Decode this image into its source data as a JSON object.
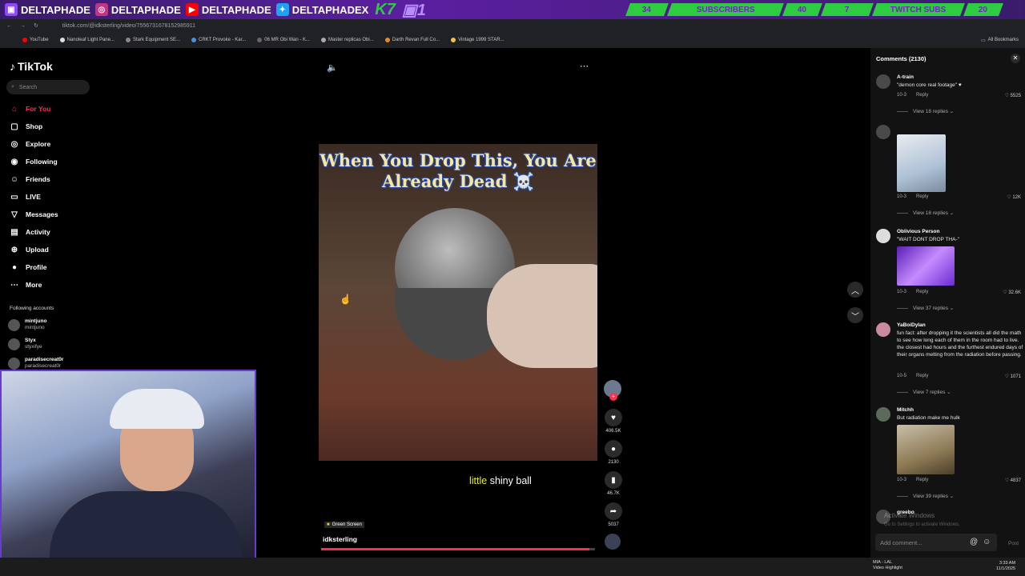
{
  "stream_overlay": {
    "handles": [
      {
        "icon": "twitch-icon",
        "label": "DELTAPHADE"
      },
      {
        "icon": "instagram-icon",
        "label": "DELTAPHADE"
      },
      {
        "icon": "youtube-icon",
        "label": "DELTAPHADE"
      },
      {
        "icon": "twitter-icon",
        "label": "DELTAPHADEX"
      }
    ],
    "kick_count": "7",
    "twitch_count": "1",
    "subs_current": "34",
    "subs_label": "SUBSCRIBERS",
    "subs_goal": "40",
    "twitch_subs_current": "7",
    "twitch_subs_label": "TWITCH SUBS",
    "twitch_subs_goal": "20"
  },
  "browser": {
    "url": "tiktok.com/@idksterling/video/7556731678152985911",
    "bookmarks": [
      "YouTube",
      "Nanoleaf Light Pane...",
      "Stark Equipment SE...",
      "CRKT Provoke - Kar...",
      "06 MR Obi Wan - K...",
      "Master replicas Obi...",
      "Darth Revan Full Co...",
      "Vintage 1999 STAR..."
    ],
    "all_bookmarks": "All Bookmarks"
  },
  "sidebar": {
    "logo": "TikTok",
    "search_placeholder": "Search",
    "items": [
      {
        "label": "For You",
        "icon": "home-icon"
      },
      {
        "label": "Shop",
        "icon": "shop-icon"
      },
      {
        "label": "Explore",
        "icon": "explore-icon"
      },
      {
        "label": "Following",
        "icon": "following-icon"
      },
      {
        "label": "Friends",
        "icon": "friends-icon"
      },
      {
        "label": "LIVE",
        "icon": "live-icon"
      },
      {
        "label": "Messages",
        "icon": "messages-icon"
      },
      {
        "label": "Activity",
        "icon": "activity-icon"
      },
      {
        "label": "Upload",
        "icon": "upload-icon"
      },
      {
        "label": "Profile",
        "icon": "profile-icon"
      },
      {
        "label": "More",
        "icon": "more-icon"
      }
    ],
    "following_title": "Following accounts",
    "following": [
      {
        "name": "mintjuno",
        "handle": "mintjuno"
      },
      {
        "name": "Styx",
        "handle": "styxifye"
      },
      {
        "name": "paradisecreat0r",
        "handle": "paradisecreat0r"
      }
    ]
  },
  "video": {
    "caption": "When You Drop This, You Are Already Dead ☠️",
    "subtitle_highlight": "little",
    "subtitle_rest": " shiny ball",
    "effect_label": "Green Screen",
    "username": "idksterling",
    "progress": 0.98,
    "likes": "406.5K",
    "comments": "2130",
    "saves": "46.7K",
    "shares": "5037"
  },
  "comments": {
    "title": "Comments (2130)",
    "items": [
      {
        "name": "A-train",
        "text": "\"demon core real footage\" ♥",
        "date": "10-3",
        "likes": "5525",
        "replies": "View 18 replies"
      },
      {
        "name": "",
        "text": "",
        "date": "10-3",
        "likes": "12K",
        "replies": "View 18 replies"
      },
      {
        "name": "Oblivious Person",
        "text": "\"WAIT DONT DROP THA-\"",
        "date": "10-3",
        "likes": "32.6K",
        "replies": "View 37 replies"
      },
      {
        "name": "YaBoiDylan",
        "text": "fun fact: after dropping it the scientists all did the math to see how long each of them in the room had to live. the closest had hours and the furthest endured days of their organs melting from the radiation before passing.",
        "date": "10-5",
        "likes": "1071",
        "replies": "View 7 replies"
      },
      {
        "name": "Mitchh",
        "text": "But radiation make me hulk",
        "date": "10-3",
        "likes": "4837",
        "replies": "View 39 replies"
      },
      {
        "name": "greebo",
        "text": "",
        "date": "",
        "likes": "",
        "replies": ""
      }
    ],
    "reply_label": "Reply",
    "add_placeholder": "Add comment...",
    "post_label": "Post"
  },
  "windows": {
    "activate_title": "Activate Windows",
    "activate_sub": "Go to Settings to activate Windows.",
    "weather_title": "MIA - LAL",
    "weather_sub": "Video Highlight",
    "time": "3:33 AM",
    "date": "11/1/2025"
  },
  "colors": {
    "accent": "#fe2c55",
    "overlay_purple": "#5b1fa0",
    "overlay_green": "#2ecc40"
  }
}
